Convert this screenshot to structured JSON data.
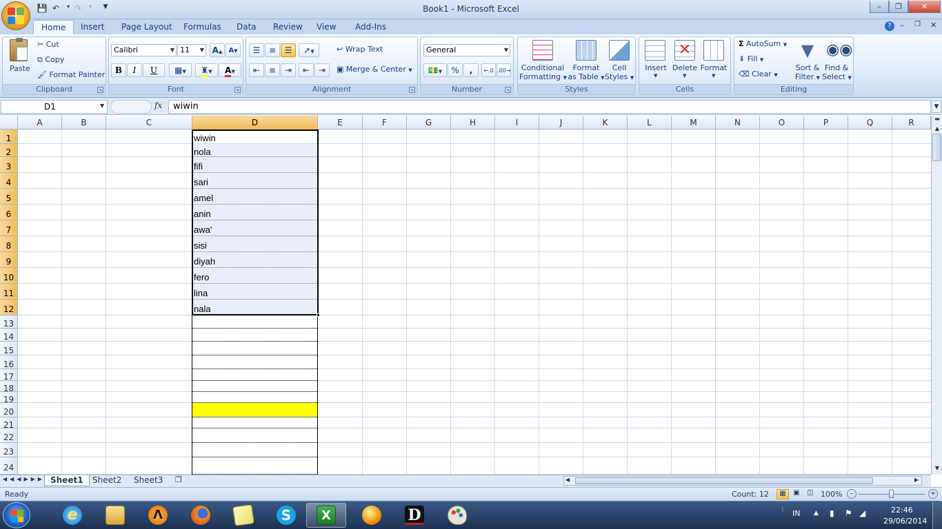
{
  "window": {
    "title": "Book1 - Microsoft Excel"
  },
  "tabs": [
    "Home",
    "Insert",
    "Page Layout",
    "Formulas",
    "Data",
    "Review",
    "View",
    "Add-Ins"
  ],
  "ribbon": {
    "clipboard": {
      "label": "Clipboard",
      "paste": "Paste",
      "cut": "Cut",
      "copy": "Copy",
      "format_painter": "Format Painter"
    },
    "font": {
      "label": "Font",
      "family": "Calibri",
      "size": "11",
      "bold": "B",
      "italic": "I",
      "underline": "U"
    },
    "alignment": {
      "label": "Alignment",
      "wrap_text": "Wrap Text",
      "merge_center": "Merge & Center"
    },
    "number": {
      "label": "Number",
      "format": "General",
      "percent": "%",
      "comma": ","
    },
    "styles": {
      "label": "Styles",
      "conditional_1": "Conditional",
      "conditional_2": "Formatting",
      "format_table_1": "Format",
      "format_table_2": "as Table",
      "cell_styles_1": "Cell",
      "cell_styles_2": "Styles"
    },
    "cells": {
      "label": "Cells",
      "insert": "Insert",
      "delete": "Delete",
      "format": "Format"
    },
    "editing": {
      "label": "Editing",
      "autosum": "AutoSum",
      "fill": "Fill",
      "clear": "Clear",
      "sort_1": "Sort &",
      "sort_2": "Filter",
      "find_1": "Find &",
      "find_2": "Select"
    }
  },
  "formula_bar": {
    "name_box": "D1",
    "fx": "fx",
    "value": "wiwin"
  },
  "columns": [
    "A",
    "B",
    "C",
    "D",
    "E",
    "F",
    "G",
    "H",
    "I",
    "J",
    "K",
    "L",
    "M",
    "N",
    "O",
    "P",
    "Q",
    "R"
  ],
  "rows": [
    "1",
    "2",
    "3",
    "4",
    "5",
    "6",
    "7",
    "8",
    "9",
    "10",
    "11",
    "12",
    "13",
    "14",
    "15",
    "16",
    "17",
    "18",
    "19",
    "20",
    "21",
    "22",
    "23",
    "24"
  ],
  "cells_d": [
    "wiwin",
    "nola",
    "fifi",
    "sari",
    "amel",
    "anin",
    "awa'",
    "sisi",
    "diyah",
    "fero",
    "lina",
    "nala"
  ],
  "sheets": [
    "Sheet1",
    "Sheet2",
    "Sheet3"
  ],
  "status": {
    "ready": "Ready",
    "count": "Count: 12",
    "zoom": "100%"
  },
  "tray": {
    "lang": "IN",
    "time": "22:46",
    "date": "29/06/2014"
  },
  "colors": {
    "highlight": "#ffff00",
    "selection_header": "#f1bc56",
    "ribbon_blue": "#15428b"
  }
}
